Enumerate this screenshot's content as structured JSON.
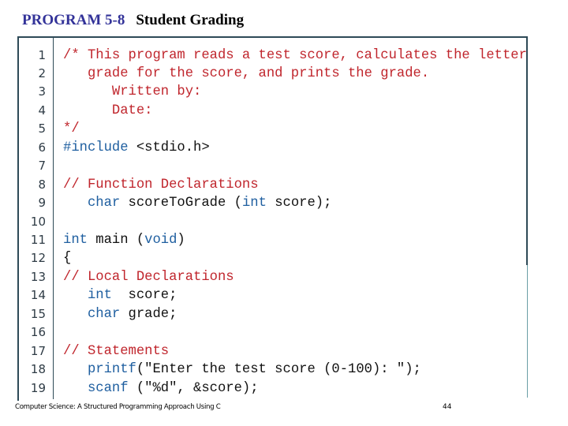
{
  "header": {
    "program_label": "PROGRAM 5-8",
    "program_title": "Student Grading"
  },
  "colors": {
    "comment": "#c0262d",
    "keyword": "#1f5fa0",
    "text": "#111111",
    "frame_border": "#2e4a57",
    "title_accent": "#333399"
  },
  "code_lines": [
    {
      "n": "1",
      "tokens": [
        {
          "t": "/* This program reads a test score, calculates the letter",
          "s": "c"
        }
      ]
    },
    {
      "n": "2",
      "tokens": [
        {
          "t": "   grade for the score, and prints the grade.",
          "s": "c"
        }
      ]
    },
    {
      "n": "3",
      "tokens": [
        {
          "t": "      Written by:",
          "s": "c"
        }
      ]
    },
    {
      "n": "4",
      "tokens": [
        {
          "t": "      Date:",
          "s": "c"
        }
      ]
    },
    {
      "n": "5",
      "tokens": [
        {
          "t": "*/",
          "s": "c"
        }
      ]
    },
    {
      "n": "6",
      "tokens": [
        {
          "t": "#include",
          "s": "k"
        },
        {
          "t": " <stdio.h>",
          "s": "t"
        }
      ]
    },
    {
      "n": "7",
      "tokens": []
    },
    {
      "n": "8",
      "tokens": [
        {
          "t": "// Function Declarations",
          "s": "c"
        }
      ]
    },
    {
      "n": "9",
      "tokens": [
        {
          "t": "   ",
          "s": "t"
        },
        {
          "t": "char",
          "s": "k"
        },
        {
          "t": " scoreToGrade (",
          "s": "t"
        },
        {
          "t": "int",
          "s": "k"
        },
        {
          "t": " score);",
          "s": "t"
        }
      ]
    },
    {
      "n": "10",
      "tokens": []
    },
    {
      "n": "11",
      "tokens": [
        {
          "t": "int",
          "s": "k"
        },
        {
          "t": " main (",
          "s": "t"
        },
        {
          "t": "void",
          "s": "k"
        },
        {
          "t": ")",
          "s": "t"
        }
      ]
    },
    {
      "n": "12",
      "tokens": [
        {
          "t": "{",
          "s": "t"
        }
      ]
    },
    {
      "n": "13",
      "tokens": [
        {
          "t": "// Local Declarations",
          "s": "c"
        }
      ]
    },
    {
      "n": "14",
      "tokens": [
        {
          "t": "   ",
          "s": "t"
        },
        {
          "t": "int",
          "s": "k"
        },
        {
          "t": "  score;",
          "s": "t"
        }
      ]
    },
    {
      "n": "15",
      "tokens": [
        {
          "t": "   ",
          "s": "t"
        },
        {
          "t": "char",
          "s": "k"
        },
        {
          "t": " grade;",
          "s": "t"
        }
      ]
    },
    {
      "n": "16",
      "tokens": []
    },
    {
      "n": "17",
      "tokens": [
        {
          "t": "// Statements",
          "s": "c"
        }
      ]
    },
    {
      "n": "18",
      "tokens": [
        {
          "t": "   ",
          "s": "t"
        },
        {
          "t": "printf",
          "s": "k"
        },
        {
          "t": "(\"Enter the test score (0-100): \");",
          "s": "t"
        }
      ]
    },
    {
      "n": "19",
      "tokens": [
        {
          "t": "   ",
          "s": "t"
        },
        {
          "t": "scanf",
          "s": "k"
        },
        {
          "t": " (\"%d\", &score);",
          "s": "t"
        }
      ]
    }
  ],
  "footer": {
    "book_title": "Computer Science: A Structured Programming Approach Using C",
    "page_number": "44"
  }
}
